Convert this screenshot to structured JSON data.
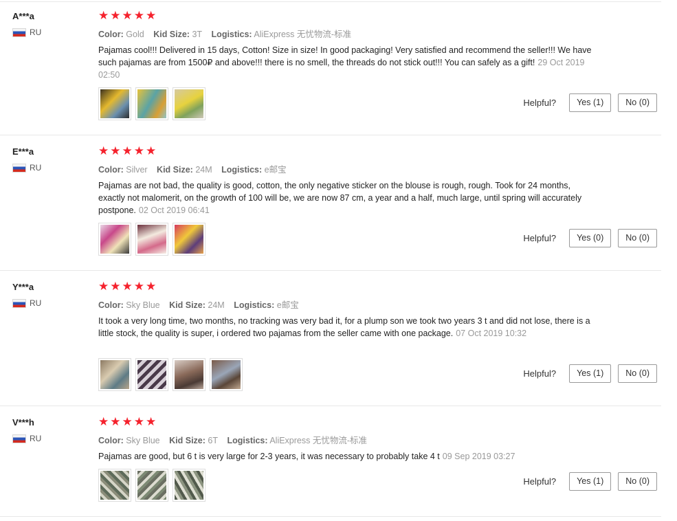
{
  "labels": {
    "color": "Color:",
    "kid_size": "Kid Size:",
    "logistics": "Logistics:",
    "helpful": "Helpful?"
  },
  "colors": {
    "star": "#f5222d",
    "divider": "#e8e8e8"
  },
  "reviews": [
    {
      "user": "A***a",
      "country": "RU",
      "stars": 5,
      "color": "Gold",
      "kid_size": "3T",
      "logistics": "AliExpress 无忧物流-标准",
      "text": "Pajamas cool!!! Delivered in 15 days, Cotton! Size in size! In good packaging! Very satisfied and recommend the seller!!! We have such pajamas are from 1500₽ and above!!! there is no smell, the threads do not stick out!!! You can safely as a gift!",
      "date": "29 Oct 2019 02:50",
      "yes": "Yes (1)",
      "no": "No (0)",
      "thumbs": [
        "photo-thumbnail",
        "photo-thumbnail",
        "photo-thumbnail"
      ]
    },
    {
      "user": "E***a",
      "country": "RU",
      "stars": 5,
      "color": "Silver",
      "kid_size": "24M",
      "logistics": "e邮宝",
      "text": "Pajamas are not bad, the quality is good, cotton, the only negative sticker on the blouse is rough, rough. Took for 24 months, exactly not malomerit, on the growth of 100 will be, we are now 87 cm, a year and a half, much large, until spring will accurately postpone.",
      "date": "02 Oct 2019 06:41",
      "yes": "Yes (0)",
      "no": "No (0)",
      "thumbs": [
        "photo-thumbnail",
        "photo-thumbnail",
        "photo-thumbnail"
      ]
    },
    {
      "user": "Y***a",
      "country": "RU",
      "stars": 5,
      "color": "Sky Blue",
      "kid_size": "24M",
      "logistics": "e邮宝",
      "text": "It took a very long time, two months, no tracking was very bad it, for a plump son we took two years 3 t and did not lose, there is a little stock, the quality is super, i ordered two pajamas from the seller came with one package.",
      "date": "07 Oct 2019 10:32",
      "yes": "Yes (1)",
      "no": "No (0)",
      "thumbs": [
        "photo-thumbnail",
        "photo-thumbnail",
        "photo-thumbnail",
        "photo-thumbnail"
      ]
    },
    {
      "user": "V***h",
      "country": "RU",
      "stars": 5,
      "color": "Sky Blue",
      "kid_size": "6T",
      "logistics": "AliExpress 无忧物流-标准",
      "text": "Pajamas are good, but 6 t is very large for 2-3 years, it was necessary to probably take 4 t",
      "date": "09 Sep 2019 03:27",
      "yes": "Yes (1)",
      "no": "No (0)",
      "thumbs": [
        "photo-thumbnail",
        "photo-thumbnail",
        "photo-thumbnail"
      ]
    }
  ]
}
